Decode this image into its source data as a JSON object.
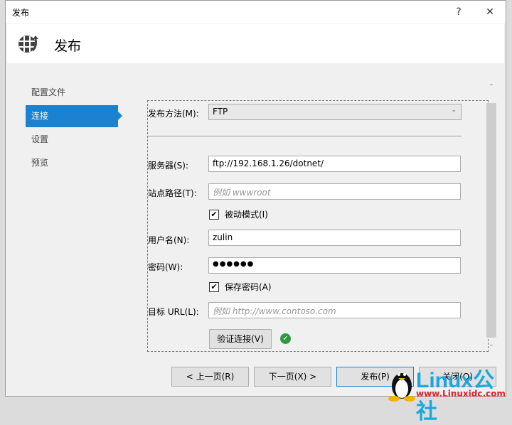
{
  "window": {
    "title": "发布",
    "help": "?",
    "close": "✕"
  },
  "header": {
    "title": "发布",
    "icon": "globe-publish-icon"
  },
  "nav": {
    "items": [
      {
        "label": "配置文件"
      },
      {
        "label": "连接",
        "active": true
      },
      {
        "label": "设置"
      },
      {
        "label": "预览"
      }
    ]
  },
  "form": {
    "method_label": "发布方法(M):",
    "method_value": "FTP",
    "server_label": "服务器(S):",
    "server_value": "ftp://192.168.1.26/dotnet/",
    "site_label": "站点路径(T):",
    "site_placeholder": "例如 wwwroot",
    "passive_label": "被动模式(I)",
    "passive_checked": true,
    "user_label": "用户名(N):",
    "user_value": "zulin",
    "password_label": "密码(W):",
    "password_value": "●●●●●●",
    "save_label": "保存密码(A)",
    "save_checked": true,
    "url_label": "目标 URL(L):",
    "url_placeholder": "例如 http://www.contoso.com",
    "validate_label": "验证连接(V)",
    "validate_status": "success"
  },
  "buttons": {
    "prev": "< 上一页(R)",
    "next": "下一页(X) >",
    "publish": "发布(P)",
    "close": "关闭(O)"
  },
  "watermark": {
    "brand": "Linux公社",
    "url": "www.Linuxidc.com"
  },
  "colors": {
    "accent": "#1a82d0",
    "success": "#2e9a3c"
  }
}
